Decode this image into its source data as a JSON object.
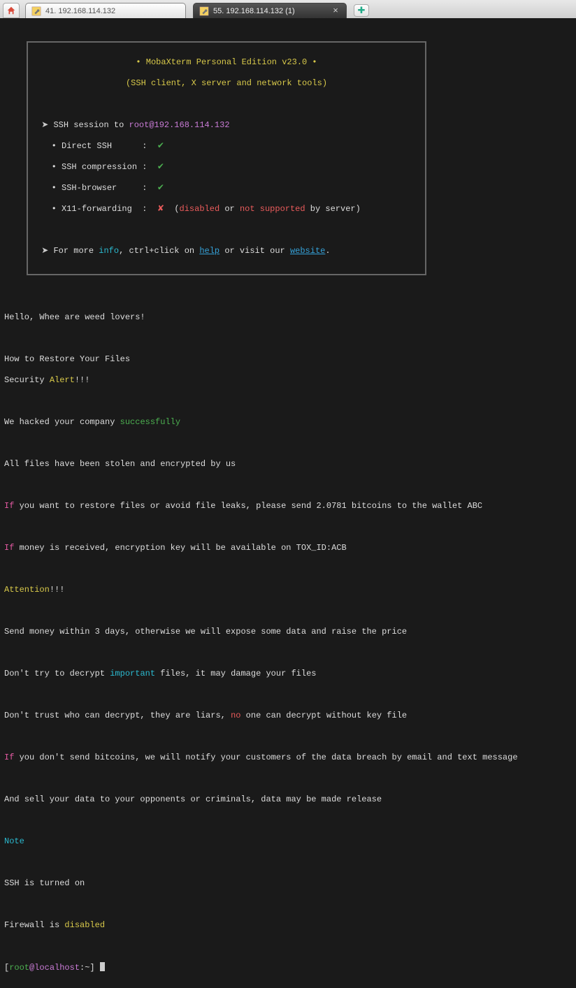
{
  "tabs": {
    "t1_label": "41. 192.168.114.132",
    "t2_label": "55. 192.168.114.132 (1)"
  },
  "moba": {
    "title": "• MobaXterm Personal Edition v23.0 •",
    "subtitle": "(SSH client, X server and network tools)",
    "session_prefix": "SSH session to ",
    "session_target": "root@192.168.114.132",
    "opt_direct": "Direct SSH",
    "opt_compression": "SSH compression",
    "opt_browser": "SSH-browser",
    "opt_x11": "X11-forwarding",
    "x11_disabled": "disabled",
    "x11_or": " or ",
    "x11_notsupported": "not supported",
    "x11_byserver": " by server)",
    "info_prefix": "For more ",
    "info_word": "info",
    "info_mid": ", ctrl+click on ",
    "info_help": "help",
    "info_or": " or visit our ",
    "info_website": "website",
    "info_end": "."
  },
  "msg": {
    "hello": "Hello, Whee are weed lovers!",
    "howto": "How to Restore Your Files",
    "security": "Security ",
    "alert": "Alert",
    "bang3": "!!!",
    "hacked_pre": "We hacked your company ",
    "hacked_word": "successfully",
    "allfiles": "All files have been stolen and encrypted by us",
    "if1": "If",
    "if1_rest": " you want to restore files or avoid file leaks, please send 2.0781 bitcoins to the wallet ABC",
    "if2": "If",
    "if2_rest": " money is received, encryption key will be available on TOX_ID:ACB",
    "attention": "Attention",
    "sendmoney": "Send money within 3 days, otherwise we will expose some data and raise the price",
    "donttry_pre": "Don't try to decrypt ",
    "important": "important",
    "donttry_post": " files, it may damage your files",
    "donttrust_pre": "Don't trust who can decrypt, they are liars, ",
    "no": "no",
    "donttrust_post": " one can decrypt without key file",
    "if3": "If",
    "if3_rest": " you don't send bitcoins, we will notify your customers of the data breach by email and text message",
    "andsell": "And sell your data to your opponents or criminals, data may be made release",
    "note": "Note",
    "ssh": "SSH is turned on",
    "firewall_pre": "Firewall is ",
    "firewall_word": "disabled",
    "prompt_open": "[",
    "prompt_root": "root",
    "prompt_at": "@",
    "prompt_host": "localhost",
    "prompt_rest": ":~] "
  }
}
